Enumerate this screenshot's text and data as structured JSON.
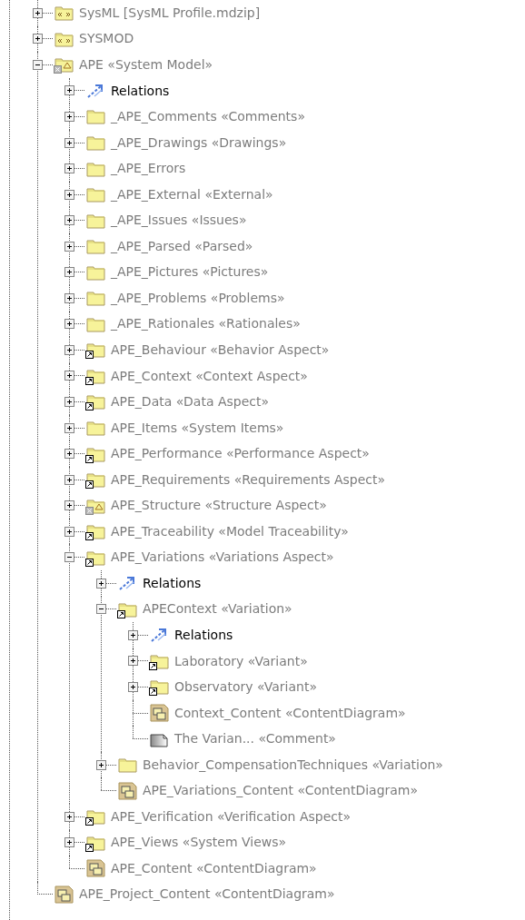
{
  "tree": [
    {
      "label": "SysML [SysML Profile.mdzip]",
      "kind": "profile",
      "expanded": false
    },
    {
      "label": "SYSMOD",
      "kind": "profile",
      "expanded": false
    },
    {
      "label": "APE «System Model»",
      "kind": "model",
      "expanded": true,
      "children": [
        {
          "label": "Relations",
          "kind": "relations",
          "expanded": false
        },
        {
          "label": "_APE_Comments «Comments»",
          "kind": "folder",
          "expanded": false
        },
        {
          "label": "_APE_Drawings «Drawings»",
          "kind": "folder",
          "expanded": false
        },
        {
          "label": "_APE_Errors",
          "kind": "folder",
          "expanded": false
        },
        {
          "label": "_APE_External «External»",
          "kind": "folder",
          "expanded": false
        },
        {
          "label": "_APE_Issues «Issues»",
          "kind": "folder",
          "expanded": false
        },
        {
          "label": "_APE_Parsed «Parsed»",
          "kind": "folder",
          "expanded": false
        },
        {
          "label": "_APE_Pictures «Pictures»",
          "kind": "folder",
          "expanded": false
        },
        {
          "label": "_APE_Problems «Problems»",
          "kind": "folder",
          "expanded": false
        },
        {
          "label": "_APE_Rationales «Rationales»",
          "kind": "folder",
          "expanded": false
        },
        {
          "label": "APE_Behaviour «Behavior Aspect»",
          "kind": "shortcut",
          "expanded": false
        },
        {
          "label": "APE_Context «Context Aspect»",
          "kind": "shortcut",
          "expanded": false
        },
        {
          "label": "APE_Data «Data Aspect»",
          "kind": "shortcut",
          "expanded": false
        },
        {
          "label": "APE_Items «System Items»",
          "kind": "folder",
          "expanded": false
        },
        {
          "label": "APE_Performance «Performance Aspect»",
          "kind": "shortcut",
          "expanded": false
        },
        {
          "label": "APE_Requirements «Requirements Aspect»",
          "kind": "shortcut",
          "expanded": false
        },
        {
          "label": "APE_Structure «Structure Aspect»",
          "kind": "model",
          "expanded": false
        },
        {
          "label": "APE_Traceability «Model Traceability»",
          "kind": "shortcut",
          "expanded": false
        },
        {
          "label": "APE_Variations «Variations Aspect»",
          "kind": "shortcut",
          "expanded": true,
          "children": [
            {
              "label": "Relations",
              "kind": "relations",
              "expanded": false
            },
            {
              "label": "APEContext «Variation»",
              "kind": "shortcut",
              "expanded": true,
              "children": [
                {
                  "label": "Relations",
                  "kind": "relations",
                  "expanded": false
                },
                {
                  "label": "Laboratory «Variant»",
                  "kind": "shortcut",
                  "expanded": false
                },
                {
                  "label": "Observatory «Variant»",
                  "kind": "shortcut",
                  "expanded": false
                },
                {
                  "label": "Context_Content «ContentDiagram»",
                  "kind": "diagram"
                },
                {
                  "label": "The Varian... «Comment»",
                  "kind": "comment"
                }
              ]
            },
            {
              "label": "Behavior_CompensationTechniques «Variation»",
              "kind": "folder",
              "expanded": false
            },
            {
              "label": "APE_Variations_Content «ContentDiagram»",
              "kind": "diagram"
            }
          ]
        },
        {
          "label": "APE_Verification «Verification Aspect»",
          "kind": "shortcut",
          "expanded": false
        },
        {
          "label": "APE_Views «System Views»",
          "kind": "shortcut",
          "expanded": false
        },
        {
          "label": "APE_Content «ContentDiagram»",
          "kind": "diagram"
        }
      ]
    },
    {
      "label": "APE_Project_Content «ContentDiagram»",
      "kind": "diagram"
    }
  ]
}
